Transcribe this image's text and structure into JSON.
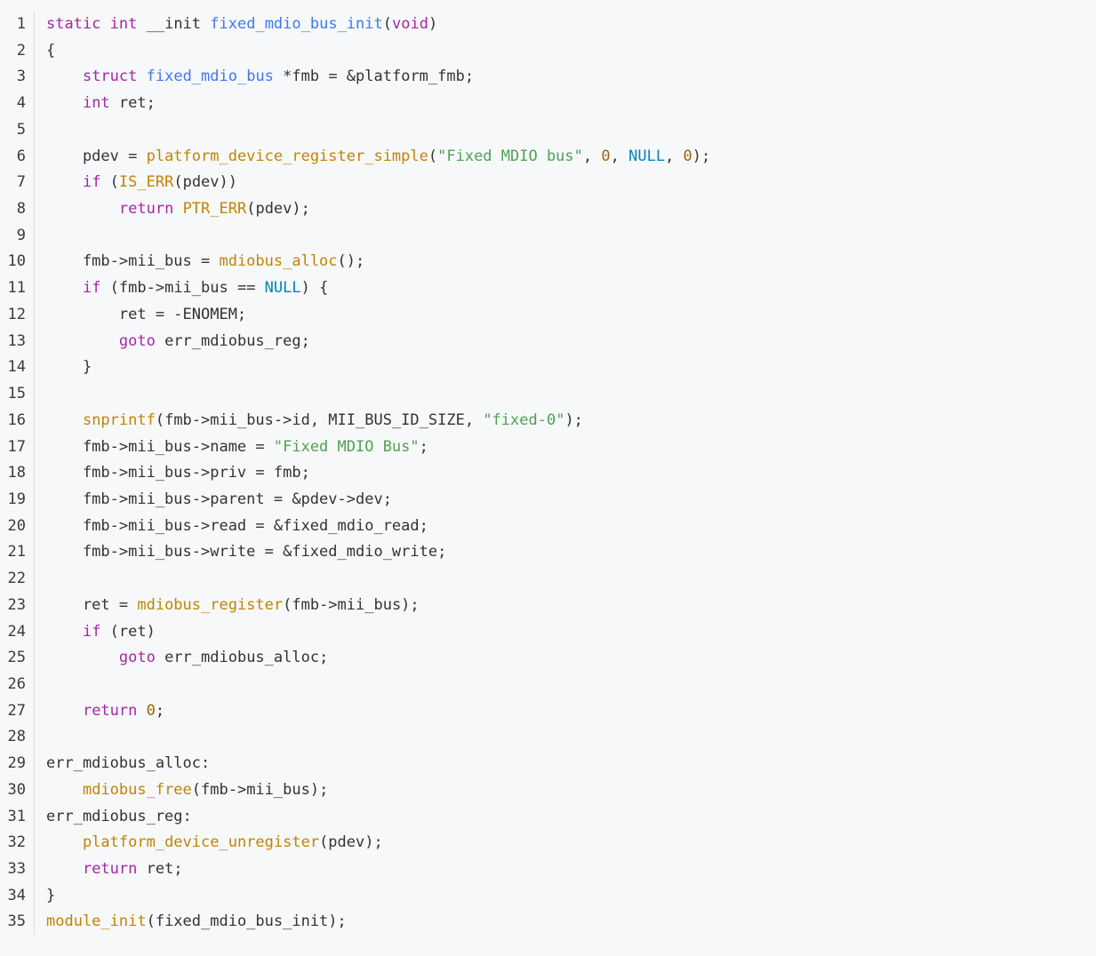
{
  "editor": {
    "lines": [
      {
        "number": "1",
        "tokens": [
          {
            "text": "static",
            "kind": "type"
          },
          {
            "text": " ",
            "kind": "plain"
          },
          {
            "text": "int",
            "kind": "type"
          },
          {
            "text": " __init ",
            "kind": "plain"
          },
          {
            "text": "fixed_mdio_bus_init",
            "kind": "identifier"
          },
          {
            "text": "(",
            "kind": "plain"
          },
          {
            "text": "void",
            "kind": "type"
          },
          {
            "text": ")",
            "kind": "plain"
          }
        ]
      },
      {
        "number": "2",
        "tokens": [
          {
            "text": "{",
            "kind": "plain"
          }
        ]
      },
      {
        "number": "3",
        "tokens": [
          {
            "text": "    ",
            "kind": "plain"
          },
          {
            "text": "struct",
            "kind": "keyword"
          },
          {
            "text": " ",
            "kind": "plain"
          },
          {
            "text": "fixed_mdio_bus",
            "kind": "identifier"
          },
          {
            "text": " *fmb = &platform_fmb;",
            "kind": "plain"
          }
        ]
      },
      {
        "number": "4",
        "tokens": [
          {
            "text": "    ",
            "kind": "plain"
          },
          {
            "text": "int",
            "kind": "type"
          },
          {
            "text": " ret;",
            "kind": "plain"
          }
        ]
      },
      {
        "number": "5",
        "tokens": []
      },
      {
        "number": "6",
        "tokens": [
          {
            "text": "    pdev = ",
            "kind": "plain"
          },
          {
            "text": "platform_device_register_simple",
            "kind": "function"
          },
          {
            "text": "(",
            "kind": "plain"
          },
          {
            "text": "\"Fixed MDIO bus\"",
            "kind": "string"
          },
          {
            "text": ", ",
            "kind": "plain"
          },
          {
            "text": "0",
            "kind": "number"
          },
          {
            "text": ", ",
            "kind": "plain"
          },
          {
            "text": "NULL",
            "kind": "constant"
          },
          {
            "text": ", ",
            "kind": "plain"
          },
          {
            "text": "0",
            "kind": "number"
          },
          {
            "text": ");",
            "kind": "plain"
          }
        ]
      },
      {
        "number": "7",
        "tokens": [
          {
            "text": "    ",
            "kind": "plain"
          },
          {
            "text": "if",
            "kind": "keyword"
          },
          {
            "text": " (",
            "kind": "plain"
          },
          {
            "text": "IS_ERR",
            "kind": "function"
          },
          {
            "text": "(pdev))",
            "kind": "plain"
          }
        ]
      },
      {
        "number": "8",
        "tokens": [
          {
            "text": "        ",
            "kind": "plain"
          },
          {
            "text": "return",
            "kind": "keyword"
          },
          {
            "text": " ",
            "kind": "plain"
          },
          {
            "text": "PTR_ERR",
            "kind": "function"
          },
          {
            "text": "(pdev);",
            "kind": "plain"
          }
        ]
      },
      {
        "number": "9",
        "tokens": []
      },
      {
        "number": "10",
        "tokens": [
          {
            "text": "    fmb->mii_bus = ",
            "kind": "plain"
          },
          {
            "text": "mdiobus_alloc",
            "kind": "function"
          },
          {
            "text": "();",
            "kind": "plain"
          }
        ]
      },
      {
        "number": "11",
        "tokens": [
          {
            "text": "    ",
            "kind": "plain"
          },
          {
            "text": "if",
            "kind": "keyword"
          },
          {
            "text": " (fmb->mii_bus == ",
            "kind": "plain"
          },
          {
            "text": "NULL",
            "kind": "constant"
          },
          {
            "text": ") {",
            "kind": "plain"
          }
        ]
      },
      {
        "number": "12",
        "tokens": [
          {
            "text": "        ret = -ENOMEM;",
            "kind": "plain"
          }
        ]
      },
      {
        "number": "13",
        "tokens": [
          {
            "text": "        ",
            "kind": "plain"
          },
          {
            "text": "goto",
            "kind": "keyword"
          },
          {
            "text": " err_mdiobus_reg;",
            "kind": "plain"
          }
        ]
      },
      {
        "number": "14",
        "tokens": [
          {
            "text": "    }",
            "kind": "plain"
          }
        ]
      },
      {
        "number": "15",
        "tokens": []
      },
      {
        "number": "16",
        "tokens": [
          {
            "text": "    ",
            "kind": "plain"
          },
          {
            "text": "snprintf",
            "kind": "function"
          },
          {
            "text": "(fmb->mii_bus->id, MII_BUS_ID_SIZE, ",
            "kind": "plain"
          },
          {
            "text": "\"fixed-0\"",
            "kind": "string"
          },
          {
            "text": ");",
            "kind": "plain"
          }
        ]
      },
      {
        "number": "17",
        "tokens": [
          {
            "text": "    fmb->mii_bus->name = ",
            "kind": "plain"
          },
          {
            "text": "\"Fixed MDIO Bus\"",
            "kind": "string"
          },
          {
            "text": ";",
            "kind": "plain"
          }
        ]
      },
      {
        "number": "18",
        "tokens": [
          {
            "text": "    fmb->mii_bus->priv = fmb;",
            "kind": "plain"
          }
        ]
      },
      {
        "number": "19",
        "tokens": [
          {
            "text": "    fmb->mii_bus->parent = &pdev->dev;",
            "kind": "plain"
          }
        ]
      },
      {
        "number": "20",
        "tokens": [
          {
            "text": "    fmb->mii_bus->read = &fixed_mdio_read;",
            "kind": "plain"
          }
        ]
      },
      {
        "number": "21",
        "tokens": [
          {
            "text": "    fmb->mii_bus->write = &fixed_mdio_write;",
            "kind": "plain"
          }
        ]
      },
      {
        "number": "22",
        "tokens": []
      },
      {
        "number": "23",
        "tokens": [
          {
            "text": "    ret = ",
            "kind": "plain"
          },
          {
            "text": "mdiobus_register",
            "kind": "function"
          },
          {
            "text": "(fmb->mii_bus);",
            "kind": "plain"
          }
        ]
      },
      {
        "number": "24",
        "tokens": [
          {
            "text": "    ",
            "kind": "plain"
          },
          {
            "text": "if",
            "kind": "keyword"
          },
          {
            "text": " (ret)",
            "kind": "plain"
          }
        ]
      },
      {
        "number": "25",
        "tokens": [
          {
            "text": "        ",
            "kind": "plain"
          },
          {
            "text": "goto",
            "kind": "keyword"
          },
          {
            "text": " err_mdiobus_alloc;",
            "kind": "plain"
          }
        ]
      },
      {
        "number": "26",
        "tokens": []
      },
      {
        "number": "27",
        "tokens": [
          {
            "text": "    ",
            "kind": "plain"
          },
          {
            "text": "return",
            "kind": "keyword"
          },
          {
            "text": " ",
            "kind": "plain"
          },
          {
            "text": "0",
            "kind": "number"
          },
          {
            "text": ";",
            "kind": "plain"
          }
        ]
      },
      {
        "number": "28",
        "tokens": []
      },
      {
        "number": "29",
        "tokens": [
          {
            "text": "err_mdiobus_alloc:",
            "kind": "plain"
          }
        ]
      },
      {
        "number": "30",
        "tokens": [
          {
            "text": "    ",
            "kind": "plain"
          },
          {
            "text": "mdiobus_free",
            "kind": "function"
          },
          {
            "text": "(fmb->mii_bus);",
            "kind": "plain"
          }
        ]
      },
      {
        "number": "31",
        "tokens": [
          {
            "text": "err_mdiobus_reg:",
            "kind": "plain"
          }
        ]
      },
      {
        "number": "32",
        "tokens": [
          {
            "text": "    ",
            "kind": "plain"
          },
          {
            "text": "platform_device_unregister",
            "kind": "function"
          },
          {
            "text": "(pdev);",
            "kind": "plain"
          }
        ]
      },
      {
        "number": "33",
        "tokens": [
          {
            "text": "    ",
            "kind": "plain"
          },
          {
            "text": "return",
            "kind": "keyword"
          },
          {
            "text": " ret;",
            "kind": "plain"
          }
        ]
      },
      {
        "number": "34",
        "tokens": [
          {
            "text": "}",
            "kind": "plain"
          }
        ]
      },
      {
        "number": "35",
        "tokens": [
          {
            "text": "module_init",
            "kind": "function"
          },
          {
            "text": "(fixed_mdio_bus_init);",
            "kind": "plain"
          }
        ]
      }
    ]
  },
  "colors": {
    "background": "#f6f8fa",
    "line_number": "#3a3a3a",
    "gutter_rule": "#dcdfe3",
    "plain": "#333333",
    "keyword": "#a626a4",
    "function": "#c18401",
    "string": "#50a14f",
    "number": "#986801",
    "constant": "#0184bc",
    "identifier": "#4078f2"
  }
}
